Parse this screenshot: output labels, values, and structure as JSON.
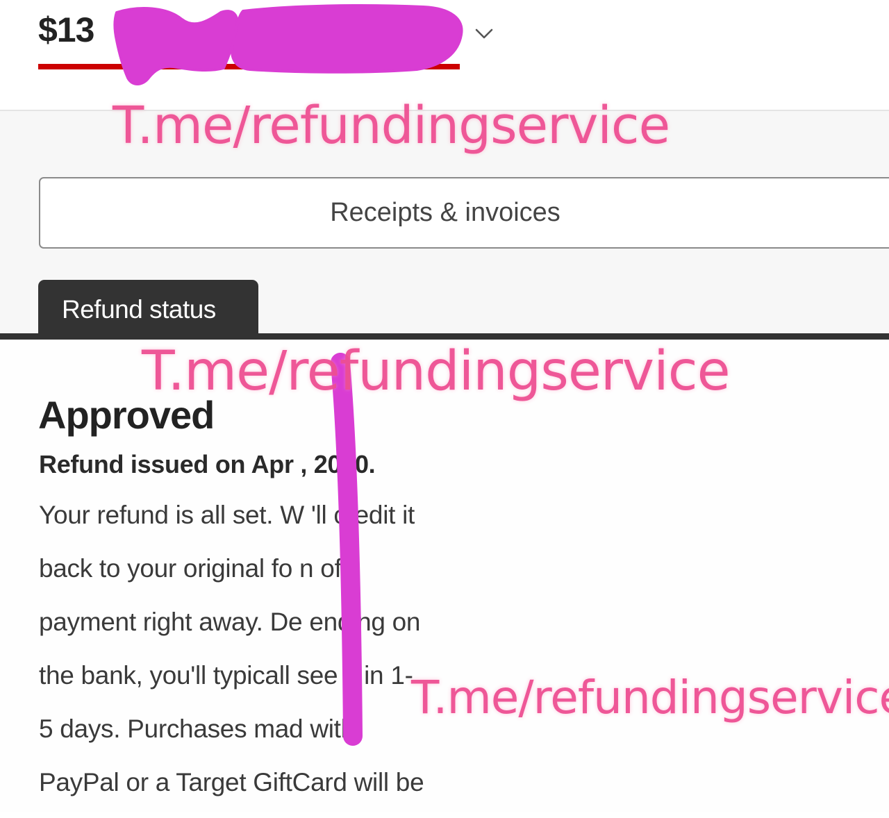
{
  "order": {
    "amount_visible": "$13"
  },
  "actions": {
    "receipts_label": "Receipts & invoices"
  },
  "tabs": [
    {
      "label": "Refund status",
      "active": true
    }
  ],
  "refund": {
    "status": "Approved",
    "issued_line": "Refund issued on Apr , 2020.",
    "body_lines": [
      "Your refund is all set. W 'll credit it",
      "back to your original fo  n of",
      "payment right away. De  ending on",
      "the bank, you'll typicall  see it in 1-",
      "5 days. Purchases mad  with",
      "PayPal or a Target GiftCard will be"
    ]
  },
  "watermark": {
    "text": "T.me/refundingservice"
  },
  "colors": {
    "accent_red": "#cc0000",
    "tab_dark": "#333333",
    "censor_magenta": "#d93dd3",
    "watermark_pink": "#ee4f92"
  },
  "icons": {
    "dropdown": "chevron-down-icon"
  }
}
